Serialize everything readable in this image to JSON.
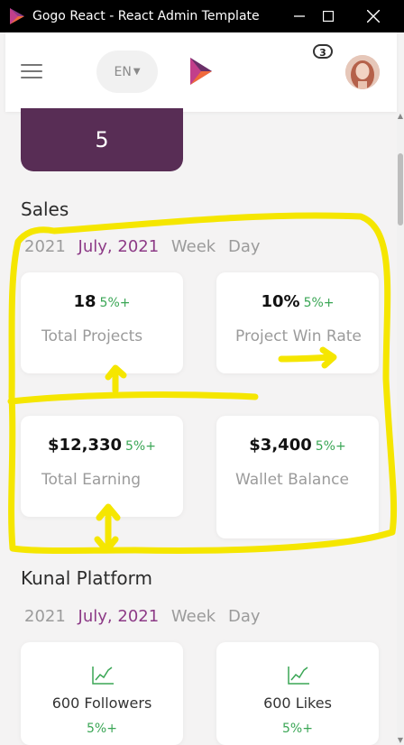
{
  "window": {
    "title": "Gogo React - React Admin Template",
    "controls": [
      "minimize",
      "maximize",
      "close"
    ]
  },
  "appbar": {
    "language": "EN",
    "notification_count": "3"
  },
  "top_card": {
    "value": "5"
  },
  "sales": {
    "title": "Sales",
    "tabs": [
      "2021",
      "July, 2021",
      "Week",
      "Day"
    ],
    "active_tab": "July, 2021",
    "cards": [
      {
        "value": "18",
        "change": "5%+",
        "label": "Total Projects"
      },
      {
        "value": "10%",
        "change": "5%+",
        "label": "Project Win Rate"
      },
      {
        "value": "$12,330",
        "change": "5%+",
        "label": "Total Earning"
      },
      {
        "value": "$3,400",
        "change": "5%+",
        "label": "Wallet Balance"
      }
    ]
  },
  "platform": {
    "title": "Kunal Platform",
    "tabs": [
      "2021",
      "July, 2021",
      "Week",
      "Day"
    ],
    "active_tab": "July, 2021",
    "cards": [
      {
        "label": "600 Followers",
        "change": "5%+",
        "icon": "chart-line-icon"
      },
      {
        "label": "600 Likes",
        "change": "5%+",
        "icon": "chart-line-icon"
      }
    ]
  },
  "colors": {
    "accent": "#8d3b87",
    "dark_purple": "#582d55",
    "positive": "#3aa655",
    "annotation": "#f5e600"
  }
}
